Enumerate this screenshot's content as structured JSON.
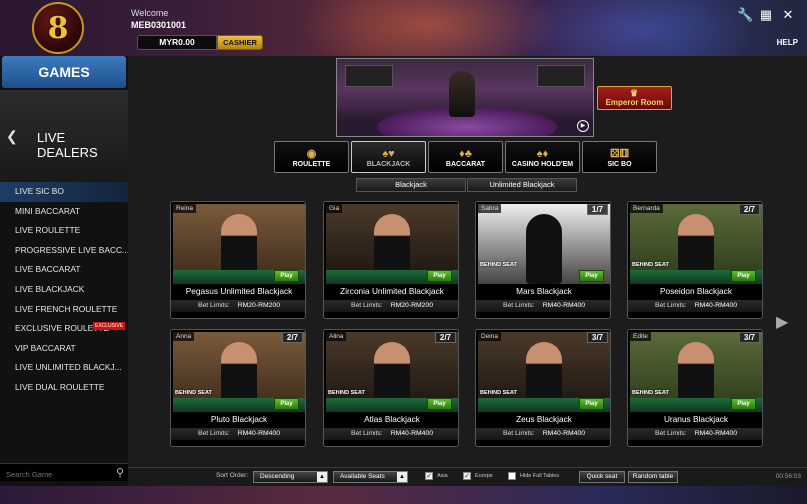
{
  "header": {
    "logo_text": "8",
    "welcome": "Welcome",
    "username": "MEB0301001",
    "balance": "MYR0.00",
    "cashier_label": "CASHIER",
    "help_label": "HELP",
    "icons": [
      "wrench-icon",
      "grid-icon",
      "close-icon"
    ]
  },
  "sidebar": {
    "games_label": "GAMES",
    "section_title": "LIVE DEALERS",
    "items": [
      {
        "label": "LIVE SIC BO",
        "active": true
      },
      {
        "label": "MINI BACCARAT"
      },
      {
        "label": "LIVE ROULETTE"
      },
      {
        "label": "PROGRESSIVE LIVE BACC..."
      },
      {
        "label": "LIVE BACCARAT"
      },
      {
        "label": "LIVE BLACKJACK"
      },
      {
        "label": "LIVE FRENCH ROULETTE"
      },
      {
        "label": "EXCLUSIVE ROULETTE",
        "badge": "EXCLUSIVE"
      },
      {
        "label": "VIP BACCARAT"
      },
      {
        "label": "LIVE UNLIMITED BLACKJ..."
      },
      {
        "label": "LIVE DUAL ROULETTE"
      }
    ],
    "search_placeholder": "Search Game"
  },
  "main": {
    "emperor_label": "Emperor Room",
    "game_tabs": [
      {
        "label": "ROULETTE"
      },
      {
        "label": "BLACKJACK",
        "active": true
      },
      {
        "label": "BACCARAT"
      },
      {
        "label": "CASINO HOLD'EM"
      },
      {
        "label": "SIC BO"
      }
    ],
    "sub_tabs": [
      "Blackjack",
      "Unlimited Blackjack"
    ],
    "limits_label": "Bet Limits:",
    "play_label": "Play",
    "behind_label": "BEHIND SEAT",
    "tables": [
      {
        "dealer": "Reina",
        "name": "Pegasus Unlimited Blackjack",
        "limits": "RM20-RM200",
        "seats": ""
      },
      {
        "dealer": "Gia",
        "name": "Zirconia Unlimited Blackjack",
        "limits": "RM20-RM200",
        "seats": ""
      },
      {
        "dealer": "Sabra",
        "name": "Mars Blackjack",
        "limits": "RM40-RM400",
        "seats": "1/7"
      },
      {
        "dealer": "Bernarda",
        "name": "Poseidon Blackjack",
        "limits": "RM40-RM400",
        "seats": "2/7"
      },
      {
        "dealer": "Anna",
        "name": "Pluto Blackjack",
        "limits": "RM40-RM400",
        "seats": "2/7"
      },
      {
        "dealer": "Alina",
        "name": "Atlas Blackjack",
        "limits": "RM40-RM400",
        "seats": "2/7"
      },
      {
        "dealer": "Deina",
        "name": "Zeus Blackjack",
        "limits": "RM40-RM400",
        "seats": "3/7"
      },
      {
        "dealer": "Edite",
        "name": "Uranus Blackjack",
        "limits": "RM40-RM400",
        "seats": "3/7"
      }
    ]
  },
  "bottom": {
    "sort_label": "Sort Order:",
    "sort_value": "Descending",
    "seats_value": "Available Seats",
    "asia_label": "Asia",
    "europe_label": "Europe",
    "hide_full_label": "Hide Full Tables",
    "quick_seat_label": "Quick seat",
    "random_table_label": "Random table",
    "clock": "00:56:03"
  }
}
